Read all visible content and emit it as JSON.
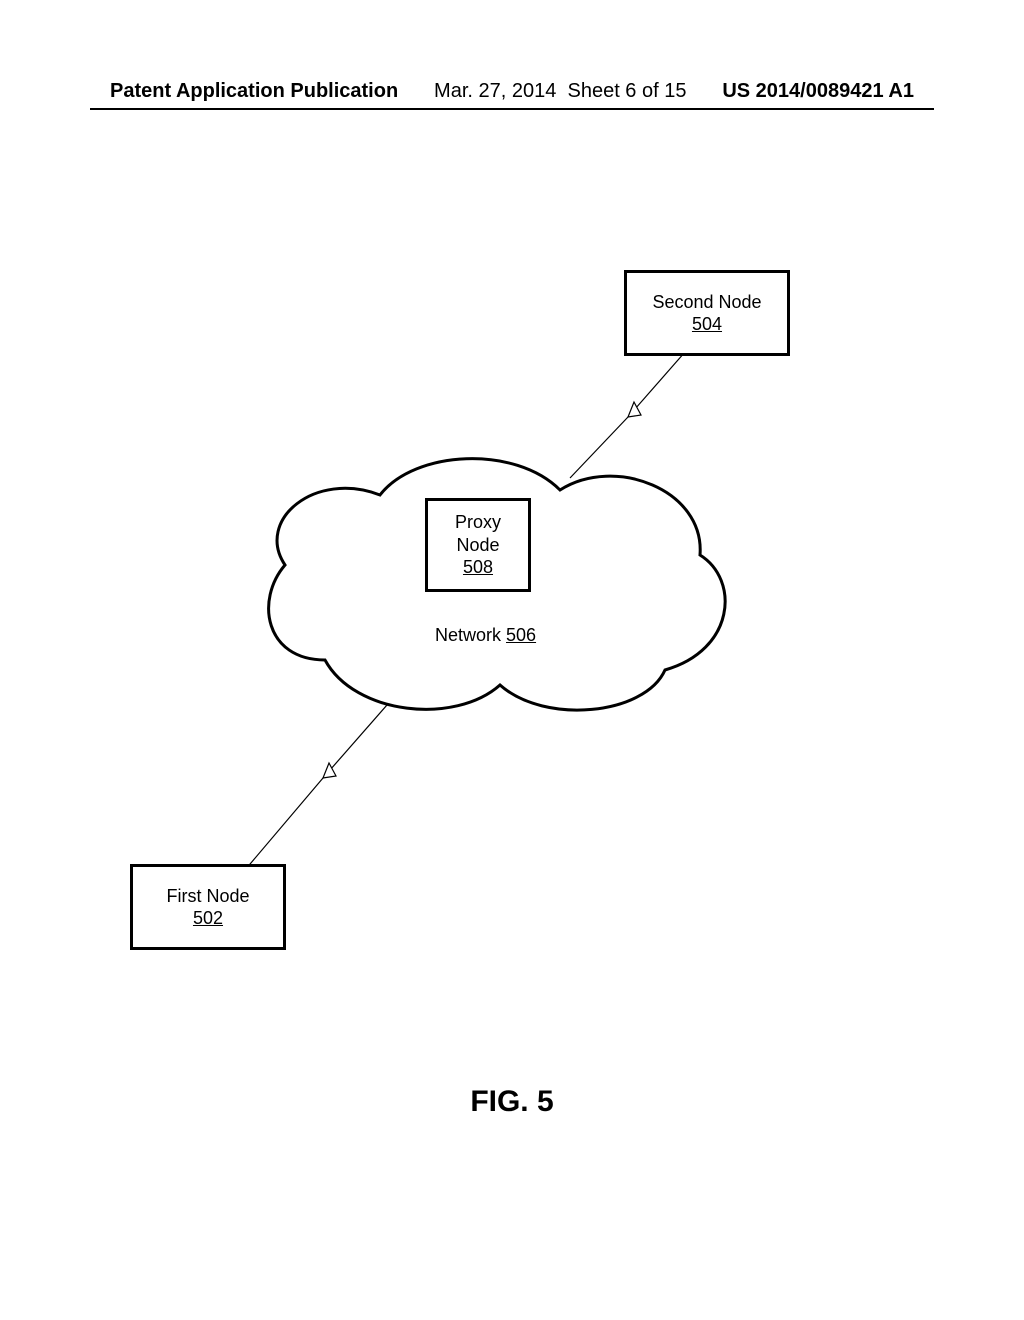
{
  "header": {
    "left": "Patent Application Publication",
    "date": "Mar. 27, 2014",
    "sheet": "Sheet 6 of 15",
    "pubno": "US 2014/0089421 A1"
  },
  "diagram": {
    "second_node": {
      "label": "Second Node",
      "ref": "504"
    },
    "first_node": {
      "label": "First Node",
      "ref": "502"
    },
    "proxy_node": {
      "line1": "Proxy",
      "line2": "Node",
      "ref": "508"
    },
    "network": {
      "label": "Network ",
      "ref": "506"
    }
  },
  "figure_label": "FIG. 5"
}
